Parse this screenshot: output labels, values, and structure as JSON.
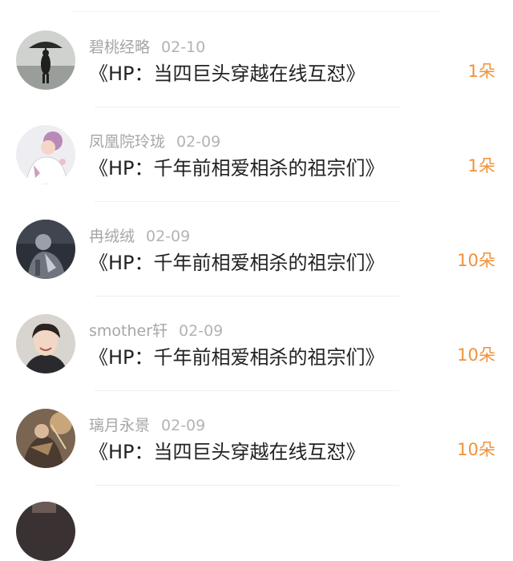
{
  "colors": {
    "username": "#a6a6a6",
    "title": "#222222",
    "count_accent": "#f0913a"
  },
  "gifts": [
    {
      "username": "碧桃经略",
      "date": "02-10",
      "title": "《HP：当四巨头穿越在线互怼》",
      "count": "1朵",
      "avatar": "avatar-silhouette-umbrella"
    },
    {
      "username": "凤凰院玲珑",
      "date": "02-09",
      "title": "《HP：千年前相爱相杀的祖宗们》",
      "count": "1朵",
      "avatar": "avatar-anime-light"
    },
    {
      "username": "冉绒绒",
      "date": "02-09",
      "title": "《HP：千年前相爱相杀的祖宗们》",
      "count": "10朵",
      "avatar": "avatar-dark-armor"
    },
    {
      "username": "smother轩",
      "date": "02-09",
      "title": "《HP：千年前相爱相杀的祖宗们》",
      "count": "10朵",
      "avatar": "avatar-photo-person"
    },
    {
      "username": "璃月永景",
      "date": "02-09",
      "title": "《HP：当四巨头穿越在线互怼》",
      "count": "10朵",
      "avatar": "avatar-game-character"
    }
  ]
}
